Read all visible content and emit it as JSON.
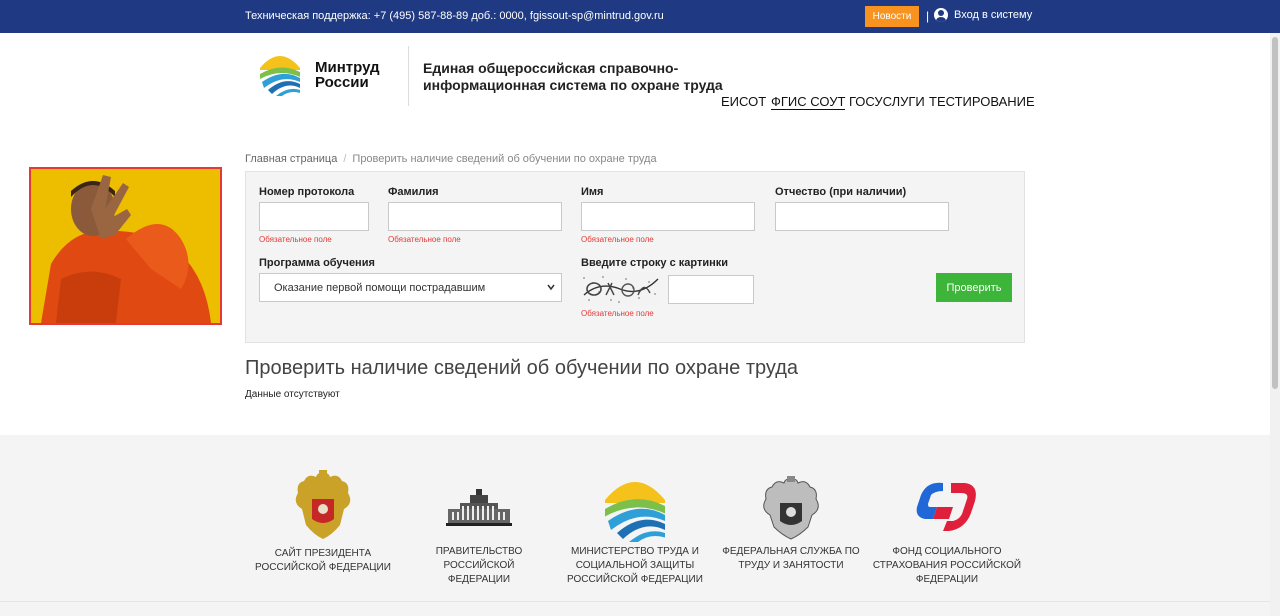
{
  "topbar": {
    "support": "Техническая поддержка: +7 (495) 587-88-89 доб.: 0000, fgissout-sp@mintrud.gov.ru",
    "news": "Новости",
    "separator": "|",
    "login": "Вход в систему"
  },
  "header": {
    "logo_line1": "Минтруд",
    "logo_line2": "России",
    "title_line1": "Единая общероссийская справочно-",
    "title_line2": "информационная система по охране труда"
  },
  "nav": [
    {
      "label": "ЕИСОТ",
      "active": false
    },
    {
      "label": "ФГИС СОУТ",
      "active": true
    },
    {
      "label": "ГОСУСЛУГИ",
      "active": false
    },
    {
      "label": "ТЕСТИРОВАНИЕ",
      "active": false
    }
  ],
  "breadcrumb": {
    "home": "Главная страница",
    "separator": "/",
    "current": "Проверить наличие сведений об обучении по охране труда"
  },
  "form": {
    "protocol_label": "Номер протокола",
    "protocol_value": "",
    "surname_label": "Фамилия",
    "surname_value": "",
    "name_label": "Имя",
    "name_value": "",
    "patronymic_label": "Отчество (при наличии)",
    "patronymic_value": "",
    "program_label": "Программа обучения",
    "program_selected": "Оказание первой помощи пострадавшим",
    "captcha_label": "Введите строку с картинки",
    "captcha_value": "",
    "required_text": "Обязательное поле",
    "submit": "Проверить"
  },
  "result": {
    "title": "Проверить наличие сведений об обучении по охране труда",
    "text": "Данные отсутствуют"
  },
  "footer": [
    {
      "line1": "САЙТ ПРЕЗИДЕНТА",
      "line2": "РОССИЙСКОЙ ФЕДЕРАЦИИ",
      "line3": "",
      "icon": "president-emblem-icon"
    },
    {
      "line1": "ПРАВИТЕЛЬСТВО РОССИЙСКОЙ",
      "line2": "ФЕДЕРАЦИИ",
      "line3": "",
      "icon": "government-building-icon"
    },
    {
      "line1": "МИНИСТЕРСТВО ТРУДА И",
      "line2": "СОЦИАЛЬНОЙ ЗАЩИТЫ",
      "line3": "РОССИЙСКОЙ ФЕДЕРАЦИИ",
      "icon": "mintrud-logo-icon"
    },
    {
      "line1": "ФЕДЕРАЛЬНАЯ СЛУЖБА ПО",
      "line2": "ТРУДУ И ЗАНЯТОСТИ",
      "line3": "",
      "icon": "rostrud-emblem-icon"
    },
    {
      "line1": "ФОНД СОЦИАЛЬНОГО",
      "line2": "СТРАХОВАНИЯ РОССИЙСКОЙ",
      "line3": "ФЕДЕРАЦИИ",
      "icon": "fss-logo-icon"
    }
  ],
  "colors": {
    "topbar": "#1f3a82",
    "news_button": "#f7931e",
    "submit_button": "#3db43a",
    "required": "#e53935"
  }
}
